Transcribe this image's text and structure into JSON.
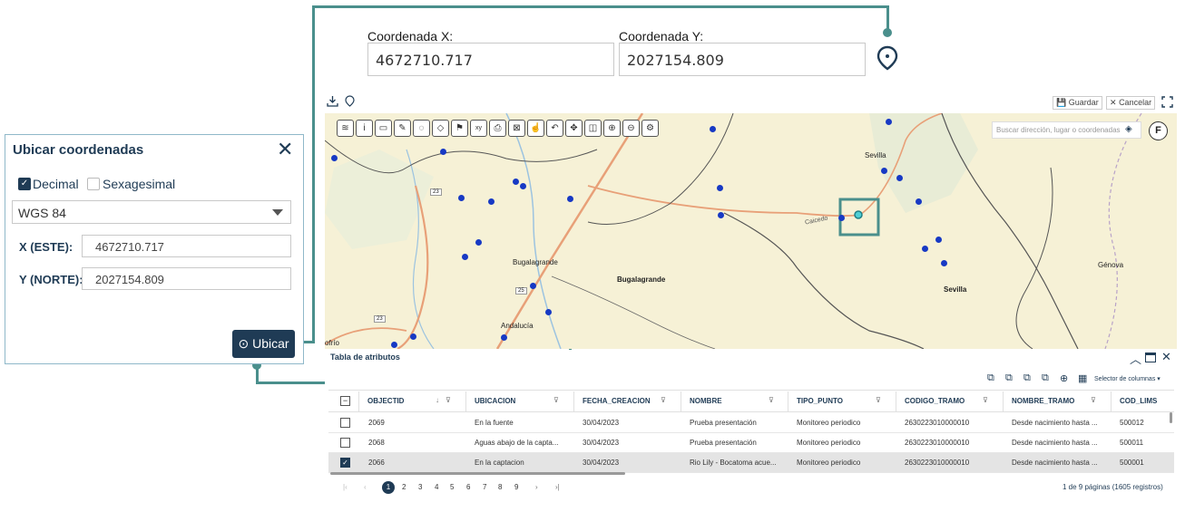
{
  "top_coords": {
    "x_label": "Coordenada X:",
    "x_value": "4672710.717",
    "y_label": "Coordenada Y:",
    "y_value": "2027154.809"
  },
  "map_toolbar": {
    "save_label": "Guardar",
    "cancel_label": "Cancelar",
    "search_placeholder": "Buscar dirección, lugar o coordenadas",
    "f_label": "F"
  },
  "panel": {
    "title": "Ubicar coordenadas",
    "decimal_label": "Decimal",
    "decimal_checked": true,
    "sexagesimal_label": "Sexagesimal",
    "sexagesimal_checked": false,
    "datum_selected": "WGS 84",
    "x_label": "X (ESTE):",
    "x_value": "4672710.717",
    "y_label": "Y (NORTE):",
    "y_value": "2027154.809",
    "ubicar_label": "Ubicar"
  },
  "map_labels": {
    "sevilla_1": "Sevilla",
    "sevilla_2": "Sevilla",
    "bugalagrande_1": "Bugalagrande",
    "bugalagrande_2": "Bugalagrande",
    "andalucia": "Andalucía",
    "genova": "Génova",
    "caicedo": "Caicedo",
    "road_23a": "23",
    "road_23b": "23",
    "road_25": "25",
    "ofrio": "ofrío"
  },
  "table": {
    "title": "Tabla de atributos",
    "column_selector": "Selector de columnas",
    "columns": [
      "OBJECTID",
      "UBICACION",
      "FECHA_CREACION",
      "NOMBRE",
      "TIPO_PUNTO",
      "CODIGO_TRAMO",
      "NOMBRE_TRAMO",
      "COD_LIMS"
    ],
    "rows": [
      {
        "checked": false,
        "cells": [
          "2069",
          "En la fuente",
          "30/04/2023",
          "Prueba presentación",
          "Monitoreo periodico",
          "2630223010000010",
          "Desde nacimiento hasta ...",
          "500012"
        ]
      },
      {
        "checked": false,
        "cells": [
          "2068",
          "Aguas abajo de la capta...",
          "30/04/2023",
          "Prueba presentación",
          "Monitoreo periodico",
          "2630223010000010",
          "Desde nacimiento hasta ...",
          "500011"
        ]
      },
      {
        "checked": true,
        "cells": [
          "2066",
          "En la captacion",
          "30/04/2023",
          "Rio Lily - Bocatoma acue...",
          "Monitoreo periodico",
          "2630223010000010",
          "Desde nacimiento hasta ...",
          "500001"
        ]
      }
    ],
    "pages": [
      "1",
      "2",
      "3",
      "4",
      "5",
      "6",
      "7",
      "8",
      "9"
    ],
    "current_page": "1",
    "summary": "1 de 9 páginas (1605 registros)"
  }
}
